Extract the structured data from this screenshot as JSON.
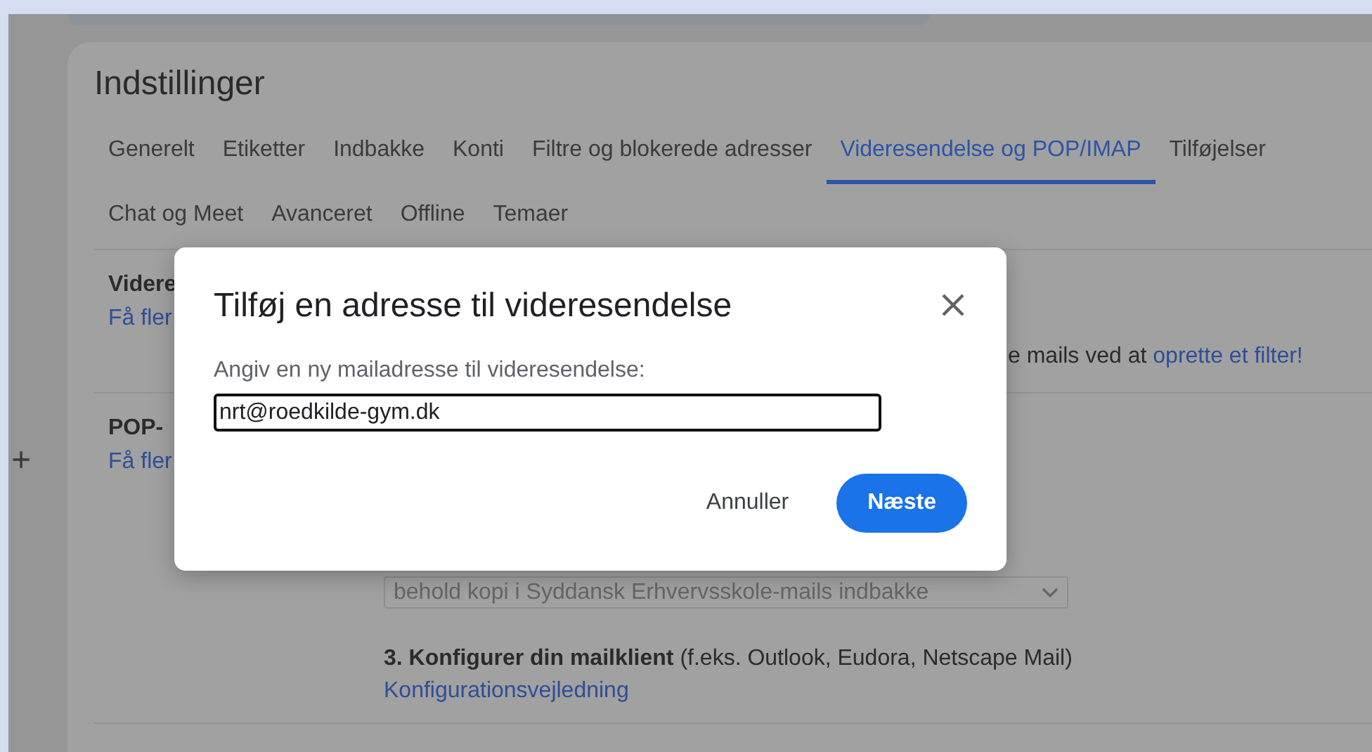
{
  "page_title": "Indstillinger",
  "tabs": [
    {
      "label": "Generelt",
      "selected": false
    },
    {
      "label": "Etiketter",
      "selected": false
    },
    {
      "label": "Indbakke",
      "selected": false
    },
    {
      "label": "Konti",
      "selected": false
    },
    {
      "label": "Filtre og blokerede adresser",
      "selected": false
    },
    {
      "label": "Videresendelse og POP/IMAP",
      "selected": true
    },
    {
      "label": "Tilføjelser",
      "selected": false
    },
    {
      "label": "Chat og Meet",
      "selected": false
    },
    {
      "label": "Avanceret",
      "selected": false
    },
    {
      "label": "Offline",
      "selected": false
    },
    {
      "label": "Temaer",
      "selected": false
    }
  ],
  "rail_button": "+",
  "sections": [
    {
      "heading": "Videre",
      "link": "Få fler",
      "note": "e mails ved at ",
      "note_link": "oprette et filter!"
    },
    {
      "heading": "POP-",
      "link": "Få fler",
      "select": {
        "value": "behold kopi i Syddansk Erhvervsskole-mails indbakke",
        "disabled": true
      },
      "step": "**3. Konfigurer din mailklient** (f.eks. Outlook, Eudora, Netscape Mail)",
      "step_link": "Konfigurationsvejledning"
    }
  ],
  "dialog": {
    "title": "Tilføj en adresse til videresendelse",
    "label": "Angiv en ny mailadresse til videresendelse:",
    "value": "nrt@roedkilde-gym.dk",
    "buttons": [
      {
        "label": "Annuller",
        "kind": "text"
      },
      {
        "label": "Næste",
        "kind": "primary"
      }
    ]
  }
}
